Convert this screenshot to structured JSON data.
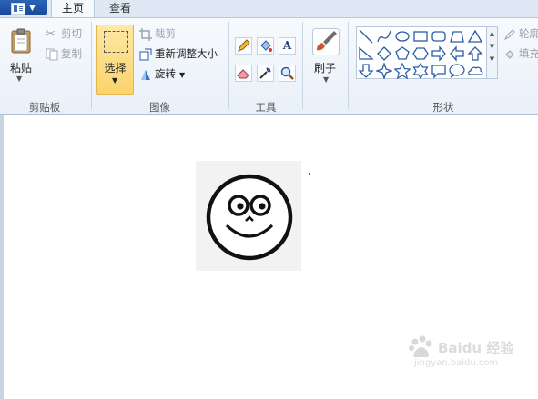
{
  "tabs": {
    "home": "主页",
    "view": "查看"
  },
  "clipboard": {
    "paste": "粘贴",
    "cut": "剪切",
    "copy": "复制",
    "group_label": "剪贴板"
  },
  "image": {
    "select": "选择",
    "crop": "裁剪",
    "resize": "重新调整大小",
    "rotate": "旋转",
    "group_label": "图像"
  },
  "tools": {
    "group_label": "工具",
    "text_tool": "A"
  },
  "brushes": {
    "label": "刷子"
  },
  "shapes": {
    "group_label": "形状",
    "outline": "轮廓",
    "fill": "填充"
  },
  "watermark": {
    "line1": "Baidu 经验",
    "line2": "jingyan.baidu.com"
  },
  "colors": {
    "accent_select": "#fbd36b",
    "app_menu": "#19479a",
    "ribbon_bg": "#e9f0f8"
  }
}
